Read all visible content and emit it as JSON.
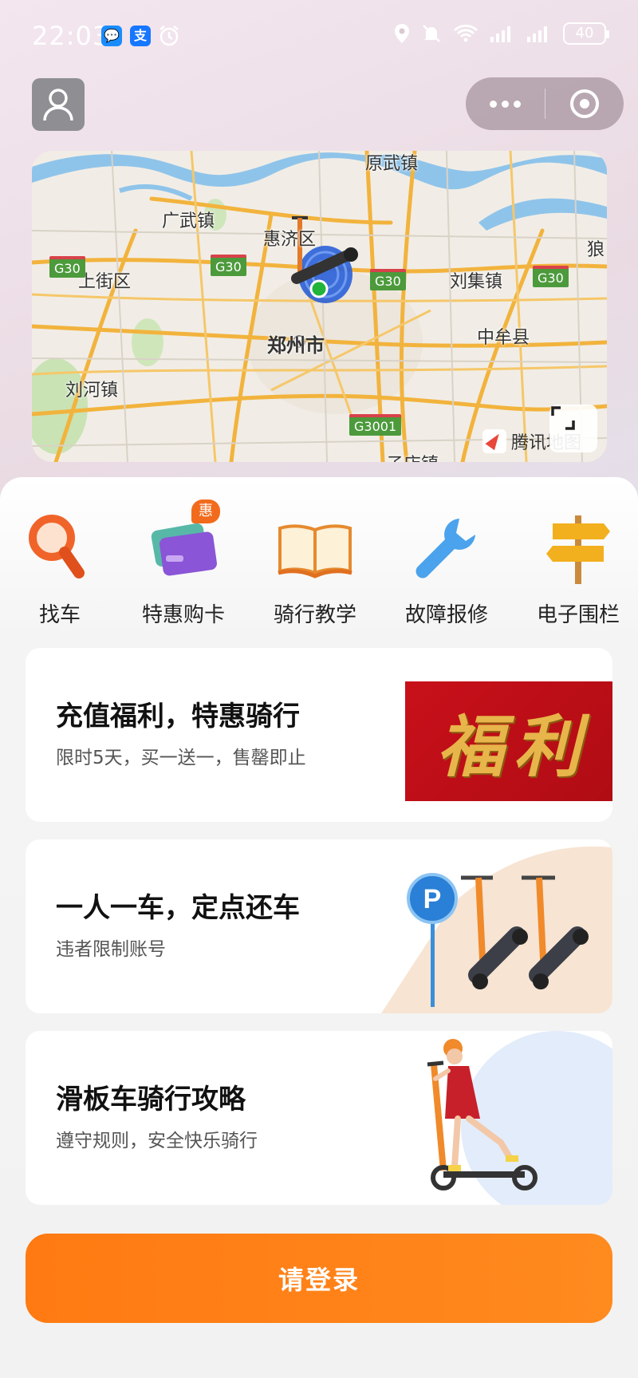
{
  "status_bar": {
    "time": "22:03",
    "app1": "💬",
    "app2": "支",
    "battery": "40"
  },
  "map": {
    "labels": [
      "原武镇",
      "广武镇",
      "惠济区",
      "上街区",
      "刘集镇",
      "郑州市",
      "中牟县",
      "刘河镇",
      "狼",
      "子店镇"
    ],
    "roads": [
      "G30",
      "G30",
      "G30",
      "G30",
      "G3001"
    ],
    "provider": "腾讯地图"
  },
  "menu": {
    "items": [
      {
        "label": "找车",
        "icon": "magnifier-icon"
      },
      {
        "label": "特惠购卡",
        "icon": "cards-icon",
        "badge": "惠"
      },
      {
        "label": "骑行教学",
        "icon": "book-icon"
      },
      {
        "label": "故障报修",
        "icon": "wrench-icon"
      },
      {
        "label": "电子围栏",
        "icon": "signpost-icon"
      }
    ]
  },
  "promos": [
    {
      "title": "充值福利，特惠骑行",
      "subtitle": "限时5天，买一送一，售罄即止",
      "image_text": [
        "福",
        "利"
      ]
    },
    {
      "title": "一人一车，定点还车",
      "subtitle": "违者限制账号",
      "image_text": [
        "P"
      ]
    },
    {
      "title": "滑板车骑行攻略",
      "subtitle": "遵守规则，安全快乐骑行"
    }
  ],
  "login_button": "请登录",
  "colors": {
    "accent": "#ff7d14",
    "badge": "#f26b1d",
    "fuli_red": "#c8101a",
    "fuli_gold": "#e7b54a"
  }
}
